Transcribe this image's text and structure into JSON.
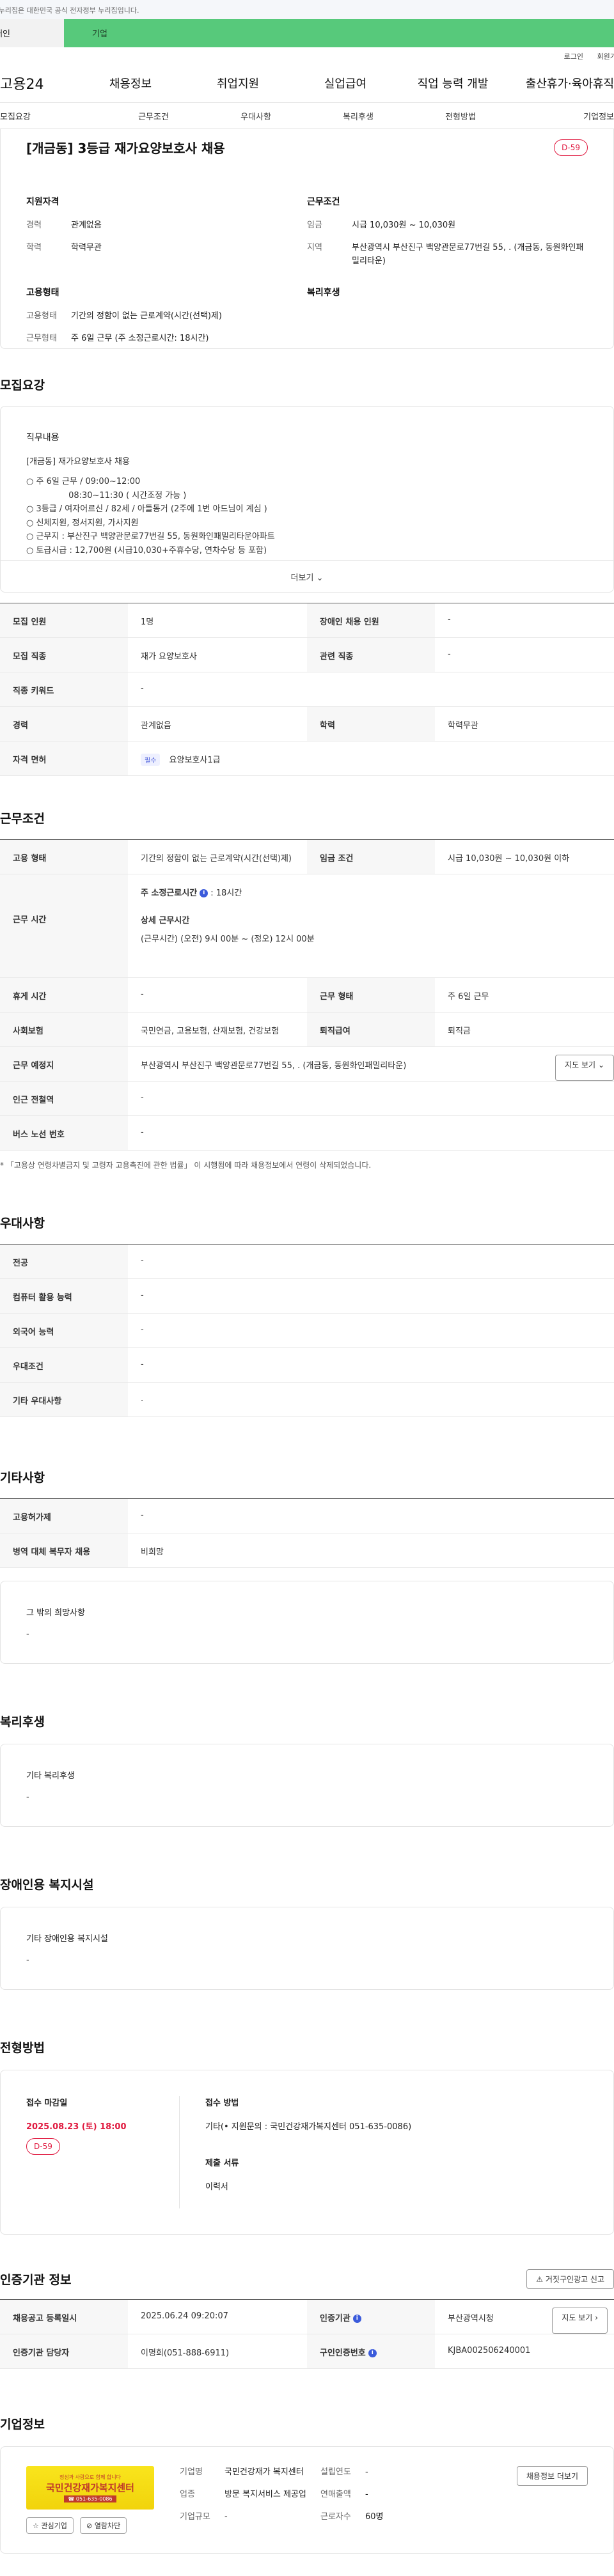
{
  "gov_banner": "이 누리집은 대한민국 공식 전자정부 누리집입니다.",
  "user_tabs": {
    "personal": "개인",
    "corporate": "기업"
  },
  "util": {
    "login": "로그인",
    "signup": "회원가입"
  },
  "nav": {
    "logo": "고용24",
    "items": [
      "채용정보",
      "취업지원",
      "실업급여",
      "직업 능력 개발",
      "출산휴가·육아휴직"
    ]
  },
  "section_nav": [
    "모집요강",
    "근무조건",
    "우대사항",
    "복리후생",
    "전형방법",
    "기업정보"
  ],
  "summary": {
    "title": "[개금동] 3등급 재가요양보호사 채용",
    "dday": "D-59",
    "qual_heading": "지원자격",
    "career_label": "경력",
    "career_value": "관계없음",
    "edu_label": "학력",
    "edu_value": "학력무관",
    "work_heading": "근무조건",
    "wage_label": "임금",
    "wage_value": "시급 10,030원 ~ 10,030원",
    "region_label": "지역",
    "region_value": "부산광역시 부산진구 백양관문로77번길 55, . (개금동, 동원화인패밀리타운)",
    "emp_heading": "고용형태",
    "emp_type_label": "고용형태",
    "emp_type_value": "기간의 정함이 없는 근로계약(시간(선택)제)",
    "work_form_label": "근무형태",
    "work_form_value": "주 6일 근무 (주 소정근로시간: 18시간)",
    "welfare_heading": "복리후생"
  },
  "recruit": {
    "title": "모집요강",
    "duty_heading": "직무내용",
    "duty_lines": [
      "[개금동] 재가요양보호사 채용",
      "",
      "○ 주 6일 근무 / 09:00~12:00",
      "                08:30~11:30 ( 시간조정 가능 )",
      "○ 3등급 / 여자어르신 / 82세 / 아들동거 (2주에 1번 아드님이 계심 )",
      "○ 신체지원, 정서지원, 가사지원",
      "○ 근무지 : 부산진구 백양관문로77번길 55, 동원화인패밀리타운아파트",
      "○ 토급시급 : 12,700원 (시급10,030+주휴수당, 연차수당 등 포함)"
    ],
    "more_label": "더보기",
    "rows": [
      {
        "label": "모집 인원",
        "value": "1명",
        "label2": "장애인 채용 인원",
        "value2": "-"
      },
      {
        "label": "모집 직종",
        "value": "재가 요양보호사",
        "label2": "관련 직종",
        "value2": "-"
      },
      {
        "label": "직종 키워드",
        "value": "-"
      },
      {
        "label": "경력",
        "value": "관계없음",
        "label2": "학력",
        "value2": "학력무관"
      }
    ],
    "license_label": "자격 면허",
    "license_tag": "필수",
    "license_value": "요양보호사1급"
  },
  "conditions": {
    "title": "근무조건",
    "emp_label": "고용 형태",
    "emp_value": "기간의 정함이 없는 근로계약(시간(선택)제)",
    "wage_label": "임금 조건",
    "wage_value": "시급 10,030원 ~ 10,030원 이하",
    "hours_label": "근무 시간",
    "hours_weekly_label": "주 소정근로시간",
    "hours_weekly_value": ": 18시간",
    "hours_detail_label": "상세 근무시간",
    "hours_detail_value": "(근무시간) (오전) 9시 00분 ~ (정오) 12시 00분",
    "rest_label": "휴게 시간",
    "rest_value": "-",
    "form_label": "근무 형태",
    "form_value": "주 6일 근무",
    "insurance_label": "사회보험",
    "insurance_value": "국민연금, 고용보험, 산재보험, 건강보험",
    "retire_label": "퇴직급여",
    "retire_value": "퇴직금",
    "place_label": "근무 예정지",
    "place_value": "부산광역시 부산진구 백양관문로77번길 55, . (개금동, 동원화인패밀리타운)",
    "map_button": "지도 보기",
    "subway_label": "인근 전철역",
    "subway_value": "-",
    "bus_label": "버스 노선 번호",
    "bus_value": "-",
    "note": "* 「고용상 연령차별금지 및 고령자 고용촉진에 관한 법률」 이 시행됨에 따라 채용정보에서 연령이 삭제되었습니다."
  },
  "preference": {
    "title": "우대사항",
    "rows": [
      {
        "label": "전공",
        "value": "-"
      },
      {
        "label": "컴퓨터 활용 능력",
        "value": "-"
      },
      {
        "label": "외국어 능력",
        "value": "-"
      },
      {
        "label": "우대조건",
        "value": "-"
      },
      {
        "label": "기타 우대사항",
        "value": "."
      }
    ]
  },
  "etc": {
    "title": "기타사항",
    "rows": [
      {
        "label": "고용허가제",
        "value": "-"
      },
      {
        "label": "병역 대체 복무자 채용",
        "value": "비희망"
      }
    ],
    "other_heading": "그 밖의 희망사항",
    "other_value": "-"
  },
  "welfare": {
    "title": "복리후생",
    "heading": "기타 복리후생",
    "value": "-"
  },
  "disabled": {
    "title": "장애인용 복지시설",
    "heading": "기타 장애인용 복지시설",
    "value": "-"
  },
  "selection": {
    "title": "전형방법",
    "deadline_label": "접수 마감일",
    "deadline_value": "2025.08.23 (토) 18:00",
    "dday": "D-59",
    "method_label": "접수 방법",
    "method_value": "기타(• 지원문의 : 국민건강재가복지센터 051-635-0086)",
    "docs_label": "제출 서류",
    "docs_value": "이력서"
  },
  "certification": {
    "title": "인증기관 정보",
    "report_button": "거짓구인광고 신고",
    "posted_label": "채용공고 등록일시",
    "posted_value": "2025.06.24 09:20:07",
    "agency_label": "인증기관",
    "agency_value": "부산광역시청",
    "map_button": "지도 보기",
    "manager_label": "인증기관 담당자",
    "manager_value": "이명희(051-888-6911)",
    "auth_no_label": "구인인증번호",
    "auth_no_value": "KJBA002506240001"
  },
  "company": {
    "title": "기업정보",
    "logo_small": "정성과 사랑으로 함께 합니다",
    "logo_big": "국민건강재가복지센터",
    "logo_sub": "☎ 051-635-0086",
    "interest_button": "관심기업",
    "block_button": "열람차단",
    "name_label": "기업명",
    "name_value": "국민건강재가 복지센터",
    "industry_label": "업종",
    "industry_value": "방문 복지서비스 제공업",
    "size_label": "기업규모",
    "size_value": "-",
    "founded_label": "설립연도",
    "founded_value": "-",
    "revenue_label": "연매출액",
    "revenue_value": "-",
    "employees_label": "근로자수",
    "employees_value": "60명",
    "more_jobs_button": "채용정보 더보기"
  },
  "colors": {
    "accent_green": "#57c97b",
    "dday_red": "#e0193f",
    "info_blue": "#3b5bdb"
  }
}
